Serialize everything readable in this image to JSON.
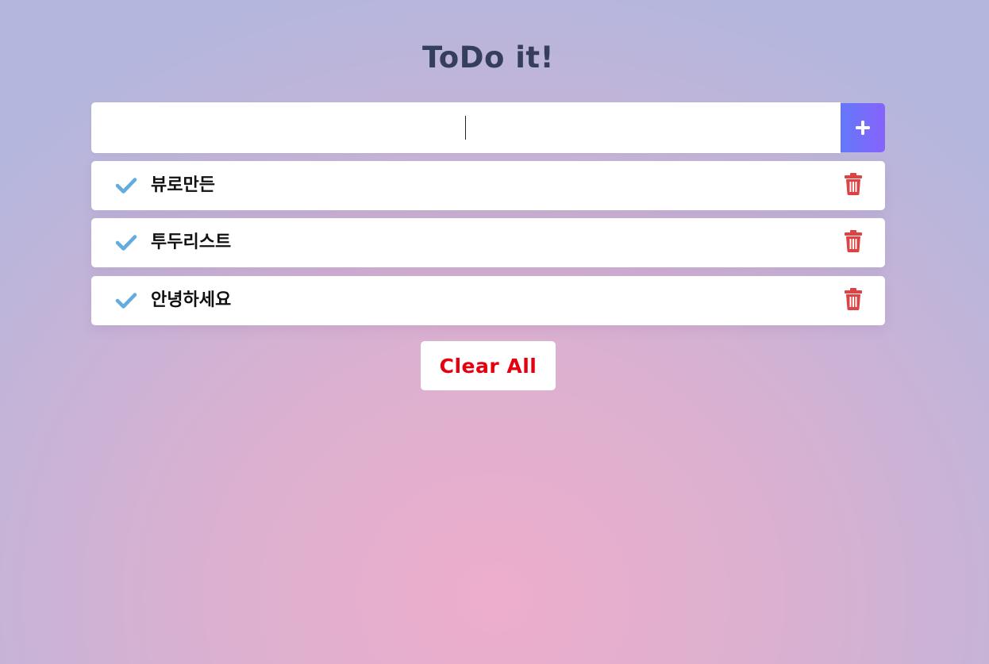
{
  "header": {
    "title": "ToDo it!"
  },
  "input": {
    "value": "",
    "placeholder": "",
    "add_icon": "plus-icon"
  },
  "todos": [
    {
      "text": "뷰로만든",
      "check_icon": "check-icon",
      "delete_icon": "trash-icon"
    },
    {
      "text": "투두리스트",
      "check_icon": "check-icon",
      "delete_icon": "trash-icon"
    },
    {
      "text": "안녕하세요",
      "check_icon": "check-icon",
      "delete_icon": "trash-icon"
    }
  ],
  "footer": {
    "clear_label": "Clear All"
  },
  "colors": {
    "title": "#353e5c",
    "check": "#62acde",
    "trash": "#de4343",
    "clear": "#e4000f",
    "add_gradient_start": "#6478fb",
    "add_gradient_end": "#8763fb"
  }
}
